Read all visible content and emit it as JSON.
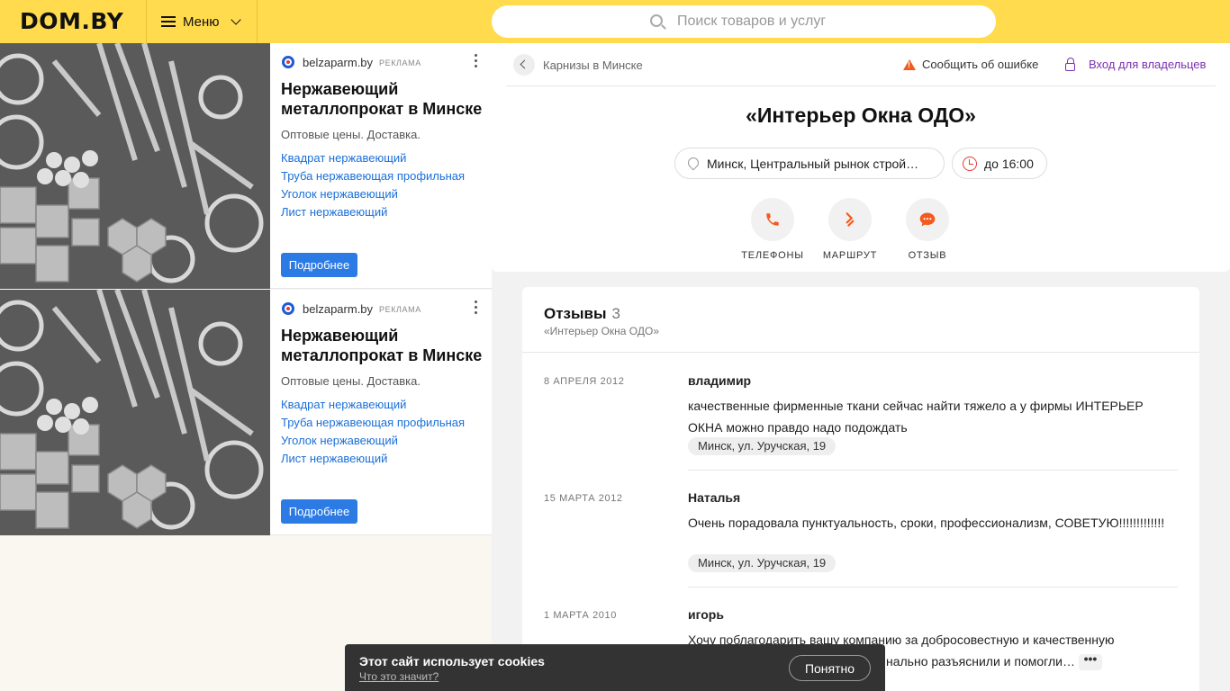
{
  "header": {
    "logo": "DOM.BY",
    "menu_label": "Меню",
    "search_placeholder": "Поиск товаров и услуг"
  },
  "ads": [
    {
      "domain": "belzaparm.by",
      "tag": "РЕКЛАМА",
      "title": "Нержавеющий металлопрокат в Минске",
      "desc": "Оптовые цены. Доставка.",
      "links": [
        "Квадрат нержавеющий",
        "Труба нержавеющая профильная",
        "Уголок нержавеющий",
        "Лист нержавеющий"
      ],
      "cta": "Подробнее"
    },
    {
      "domain": "belzaparm.by",
      "tag": "РЕКЛАМА",
      "title": "Нержавеющий металлопрокат в Минске",
      "desc": "Оптовые цены. Доставка.",
      "links": [
        "Квадрат нержавеющий",
        "Труба нержавеющая профильная",
        "Уголок нержавеющий",
        "Лист нержавеющий"
      ],
      "cta": "Подробнее"
    }
  ],
  "card": {
    "breadcrumb": "Карнизы в Минске",
    "report": "Сообщить об ошибке",
    "owner_login": "Вход для владельцев",
    "company": "«Интерьер Окна ОДО»",
    "address": "Минск, Центральный рынок строй…",
    "hours": "до 16:00",
    "actions": [
      {
        "label": "ТЕЛЕФОНЫ",
        "icon": "phone-icon"
      },
      {
        "label": "МАРШРУТ",
        "icon": "route-icon"
      },
      {
        "label": "ОТЗЫВ",
        "icon": "chat-icon"
      }
    ]
  },
  "reviews": {
    "title": "Отзывы",
    "count": "3",
    "subtitle": "«Интерьер Окна ОДО»",
    "items": [
      {
        "date": "8 АПРЕЛЯ 2012",
        "author": "владимир",
        "text": "качественные фирменные ткани сейчас найти тяжело а у фирмы ИНТЕРЬЕР ОКНА можно правдо надо подождать",
        "location": "Минск, ул. Уручская, 19"
      },
      {
        "date": "15 МАРТА 2012",
        "author": "Наталья",
        "text": "Очень порадовала пунктуальность, сроки, профессионализм, СОВЕТУЮ!!!!!!!!!!!!!",
        "location": "Минск, ул. Уручская, 19"
      },
      {
        "date": "1 МАРТА 2010",
        "author": "игорь",
        "text": "Хочу поблагодарить вашу компанию за добросовестную и качественную",
        "text_line2": "нально разъяснили и помогли…",
        "more": "•••"
      }
    ]
  },
  "cookie": {
    "title": "Этот сайт использует cookies",
    "link": "Что это значит?",
    "accept": "Понятно"
  },
  "colors": {
    "header_bg": "#ffdb4d",
    "accent_orange": "#f35a1f",
    "link_blue": "#1a6fd8",
    "owner_purple": "#7b2fb0"
  }
}
